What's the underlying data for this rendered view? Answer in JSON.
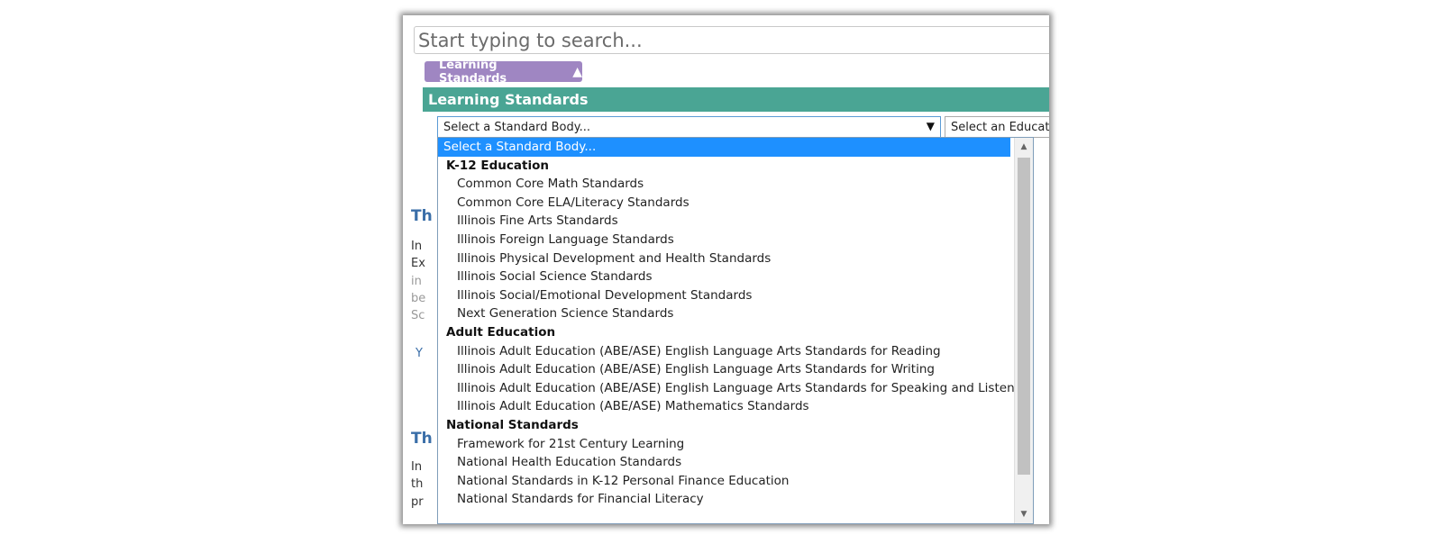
{
  "search": {
    "placeholder": "Start typing to search..."
  },
  "filter_tag": {
    "label": "Learning Standards",
    "icon": "triangle-up-icon"
  },
  "section": {
    "title": "Learning Standards"
  },
  "standard_body_select": {
    "value": "Select a Standard Body...",
    "arrow": "▼"
  },
  "education_select": {
    "value": "Select an Educatio"
  },
  "background": {
    "heading1": "Th",
    "lines1": [
      "In",
      "Ex",
      "in",
      "be",
      "Sc"
    ],
    "y": "Y",
    "heading2": "Th",
    "lines2": [
      "In",
      "th",
      "pr"
    ]
  },
  "dropdown": {
    "selected": "Select a Standard Body...",
    "groups": [
      {
        "label": "K-12 Education",
        "items": [
          "Common Core Math Standards",
          "Common Core ELA/Literacy Standards",
          "Illinois Fine Arts Standards",
          "Illinois Foreign Language Standards",
          "Illinois Physical Development and Health Standards",
          "Illinois Social Science Standards",
          "Illinois Social/Emotional Development Standards",
          "Next Generation Science Standards"
        ]
      },
      {
        "label": "Adult Education",
        "items": [
          "Illinois Adult Education (ABE/ASE) English Language Arts Standards for Reading",
          "Illinois Adult Education (ABE/ASE) English Language Arts Standards for Writing",
          "Illinois Adult Education (ABE/ASE) English Language Arts Standards for Speaking and Listening",
          "Illinois Adult Education (ABE/ASE) Mathematics Standards"
        ]
      },
      {
        "label": "National Standards",
        "items": [
          "Framework for 21st Century Learning",
          "National Health Education Standards",
          "National Standards in K-12 Personal Finance Education",
          "National Standards for Financial Literacy"
        ]
      }
    ]
  },
  "colors": {
    "tag": "#9f86c2",
    "section_bar": "#4aa594",
    "selected_option": "#1e90ff",
    "heading_blue": "#3a6ea8"
  }
}
